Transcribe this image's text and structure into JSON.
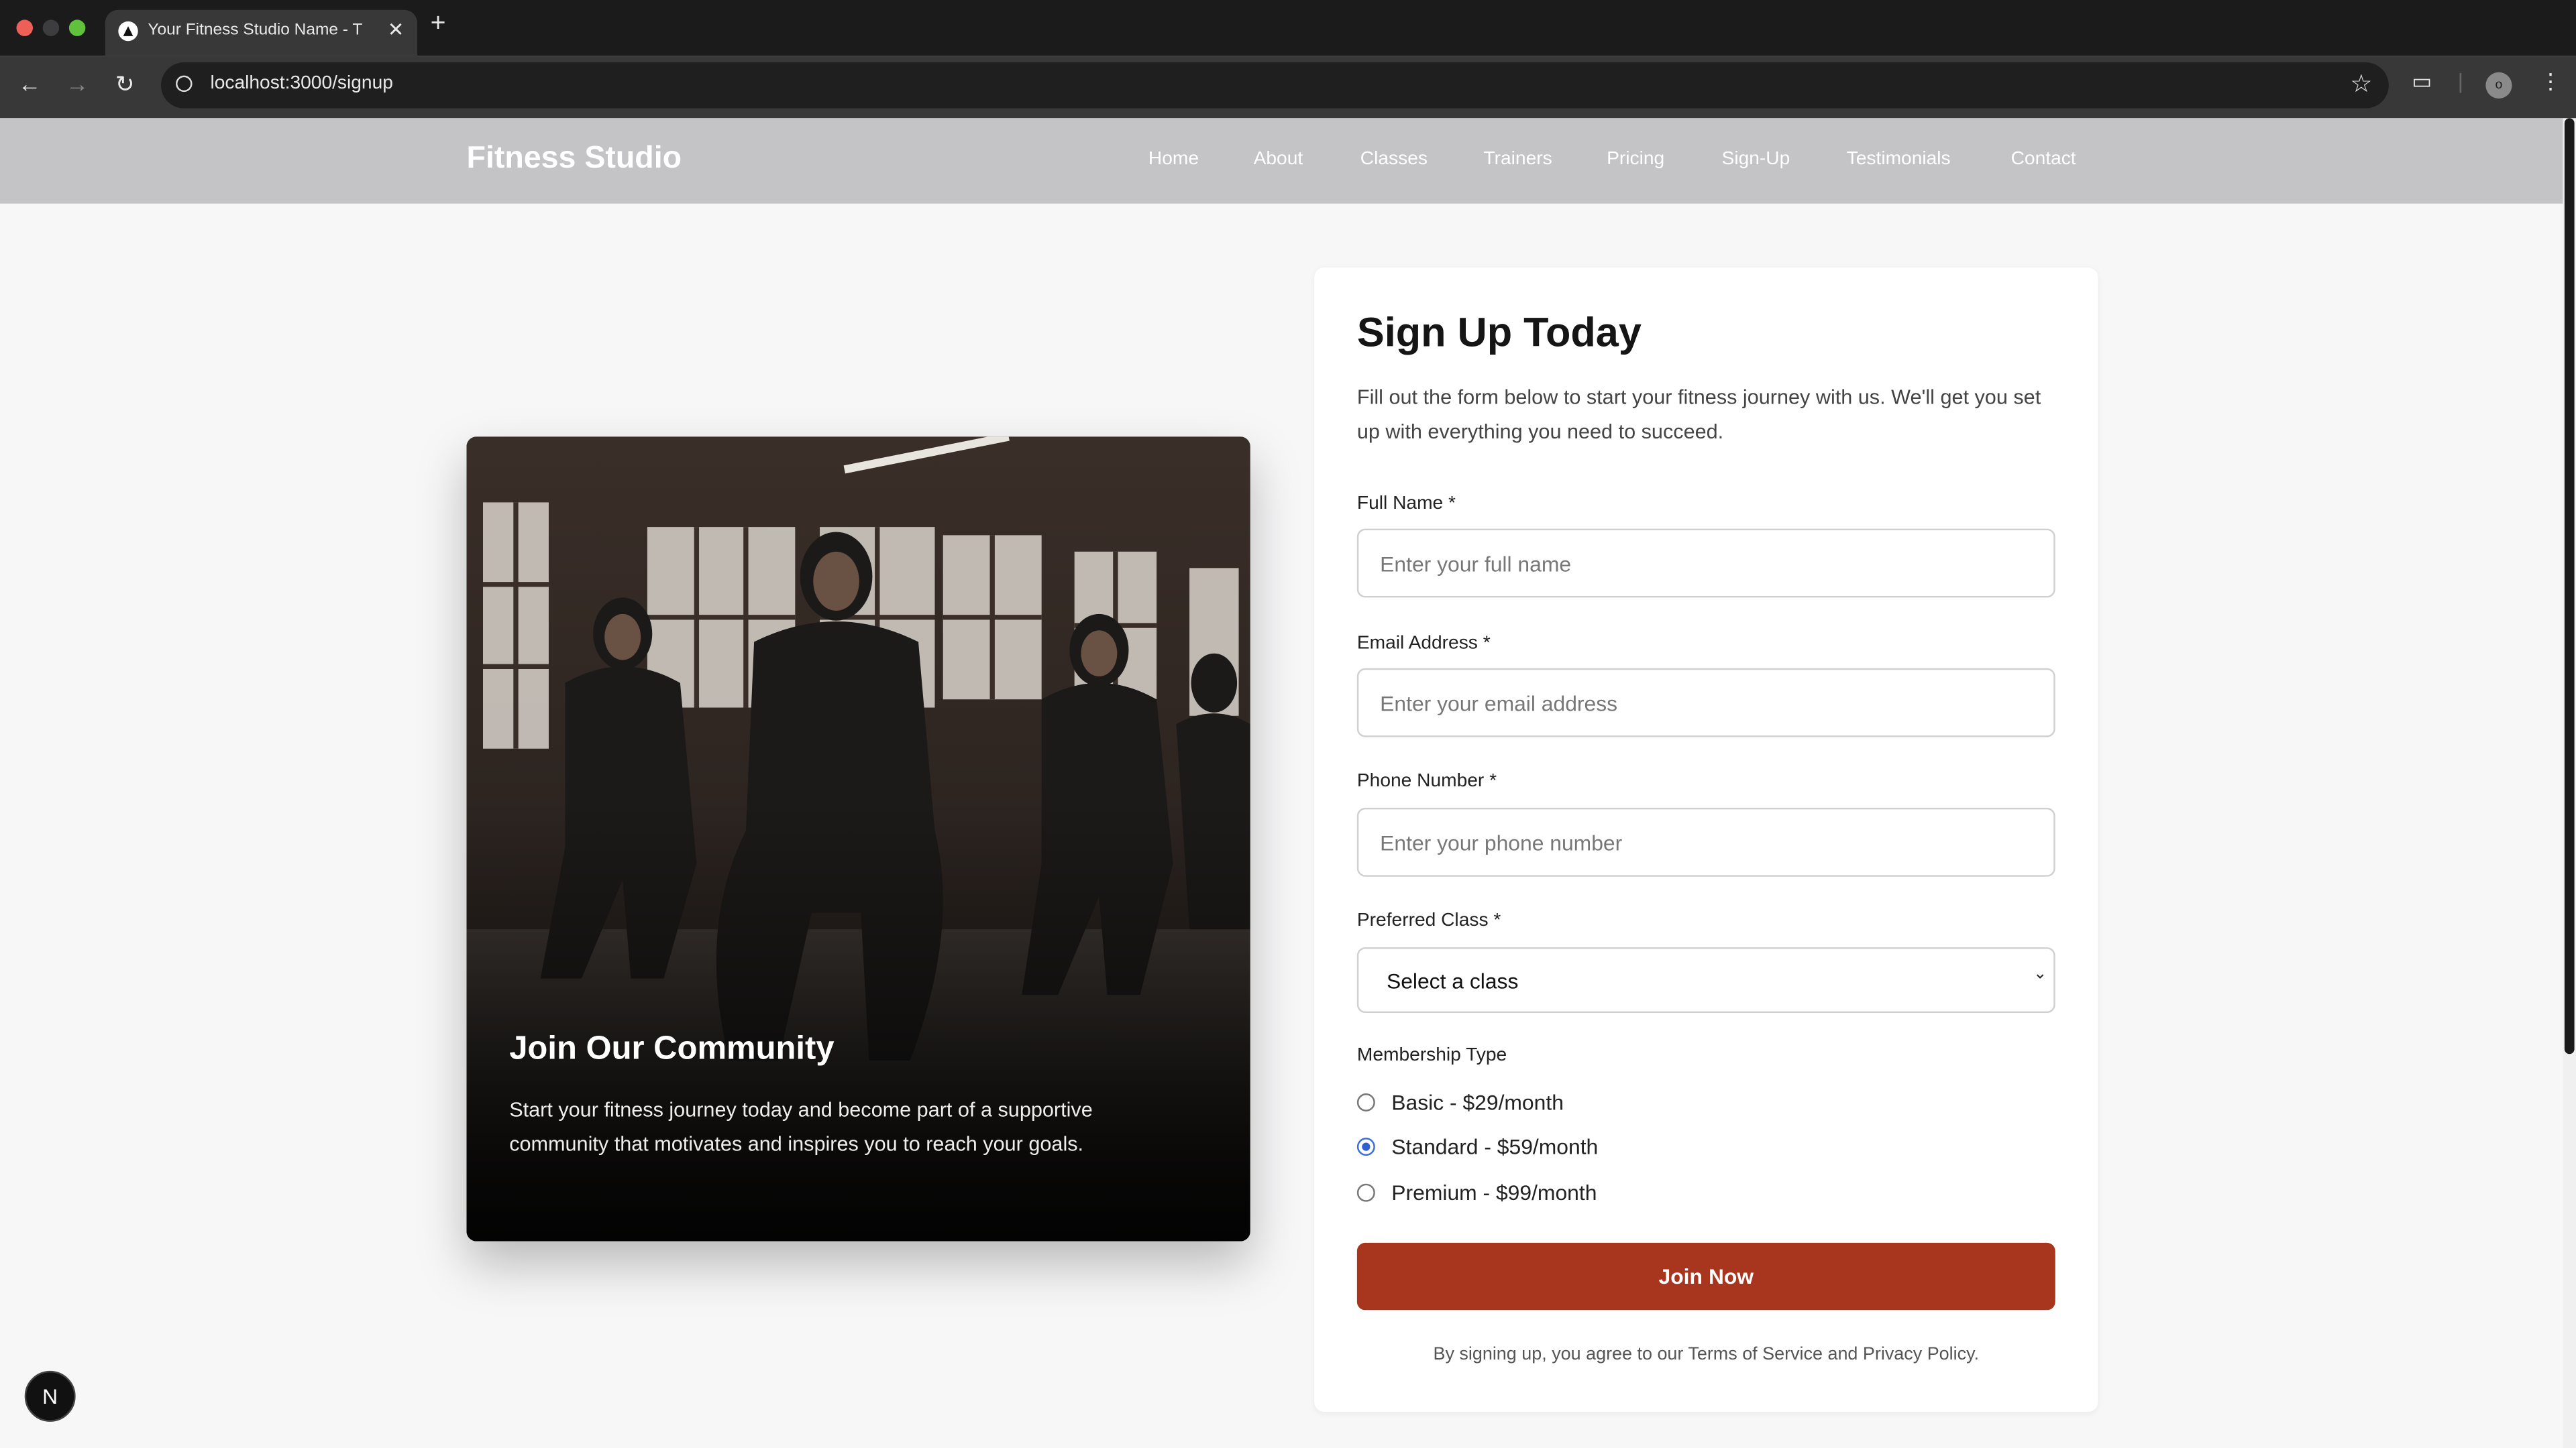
{
  "browser": {
    "tab_title": "Your Fitness Studio Name - T",
    "tab_close": "✕",
    "new_tab": "+",
    "url": "localhost:3000/signup",
    "profile_initial": "o"
  },
  "nav": {
    "brand": "Fitness Studio",
    "links": [
      "Home",
      "About",
      "Classes",
      "Trainers",
      "Pricing",
      "Sign-Up",
      "Testimonials",
      "Contact"
    ]
  },
  "hero": {
    "title": "Join Our Community",
    "text": "Start your fitness journey today and become part of a supportive community that motivates and inspires you to reach your goals."
  },
  "form": {
    "title": "Sign Up Today",
    "description": "Fill out the form below to start your fitness journey with us. We'll get you set up with everything you need to succeed.",
    "full_name_label": "Full Name *",
    "full_name_placeholder": "Enter your full name",
    "email_label": "Email Address *",
    "email_placeholder": "Enter your email address",
    "phone_label": "Phone Number *",
    "phone_placeholder": "Enter your phone number",
    "class_label": "Preferred Class *",
    "class_selected": "Select a class",
    "membership_label": "Membership Type",
    "membership_options": [
      "Basic - $29/month",
      "Standard - $59/month",
      "Premium - $99/month"
    ],
    "membership_selected": "Standard - $59/month",
    "submit_label": "Join Now",
    "terms": "By signing up, you agree to our Terms of Service and Privacy Policy."
  },
  "dev_badge": "N",
  "colors": {
    "navbar_bg": "#c4c4c6",
    "accent_button": "#a8361e",
    "radio_accent": "#2f5fd0",
    "page_bg": "#f7f7f8"
  },
  "icons": [
    "back-arrow-icon",
    "forward-arrow-icon",
    "reload-icon",
    "info-icon",
    "star-icon",
    "tab-search-icon",
    "profile-avatar",
    "more-menu-icon",
    "chevron-down-icon",
    "nextjs-badge-icon"
  ]
}
